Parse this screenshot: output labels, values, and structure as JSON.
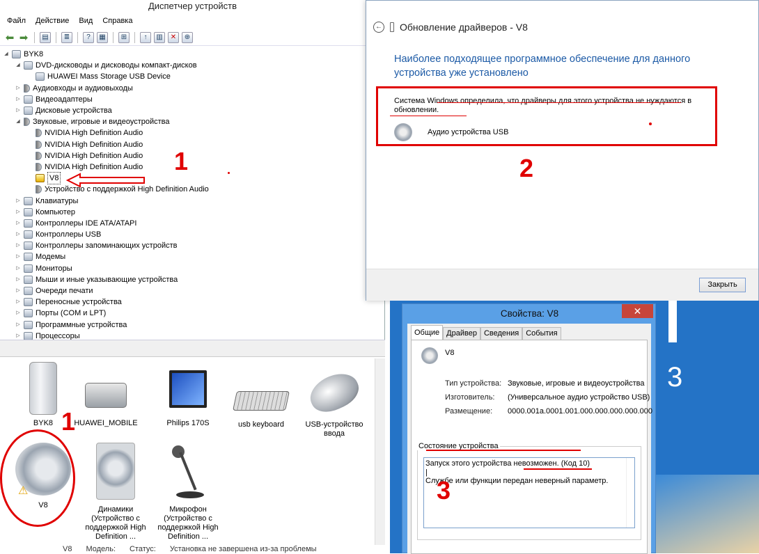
{
  "device_manager": {
    "title": "Диспетчер устройств",
    "menu": [
      "Файл",
      "Действие",
      "Вид",
      "Справка"
    ],
    "tree": [
      {
        "label": "BYK8",
        "level": 0,
        "expander": "◢",
        "icon": "computer-icon"
      },
      {
        "label": "DVD-дисководы и дисководы компакт-дисков",
        "level": 1,
        "expander": "◢",
        "icon": "dvd-drive-icon"
      },
      {
        "label": "HUAWEI Mass Storage USB Device",
        "level": 2,
        "expander": "",
        "icon": "dvd-drive-icon"
      },
      {
        "label": "Аудиовходы и аудиовыходы",
        "level": 1,
        "expander": "▷",
        "icon": "speaker-icon"
      },
      {
        "label": "Видеоадаптеры",
        "level": 1,
        "expander": "▷",
        "icon": "display-adapter-icon"
      },
      {
        "label": "Дисковые устройства",
        "level": 1,
        "expander": "▷",
        "icon": "disk-drive-icon"
      },
      {
        "label": "Звуковые, игровые и видеоустройства",
        "level": 1,
        "expander": "◢",
        "icon": "speaker-icon"
      },
      {
        "label": "NVIDIA High Definition Audio",
        "level": 2,
        "expander": "",
        "icon": "speaker-icon"
      },
      {
        "label": "NVIDIA High Definition Audio",
        "level": 2,
        "expander": "",
        "icon": "speaker-icon"
      },
      {
        "label": "NVIDIA High Definition Audio",
        "level": 2,
        "expander": "",
        "icon": "speaker-icon"
      },
      {
        "label": "NVIDIA High Definition Audio",
        "level": 2,
        "expander": "",
        "icon": "speaker-icon"
      },
      {
        "label": "V8",
        "level": 2,
        "expander": "",
        "icon": "warning-speaker-icon"
      },
      {
        "label": "Устройство с поддержкой High Definition Audio",
        "level": 2,
        "expander": "",
        "icon": "speaker-icon"
      },
      {
        "label": "Клавиатуры",
        "level": 1,
        "expander": "▷",
        "icon": "keyboard-icon"
      },
      {
        "label": "Компьютер",
        "level": 1,
        "expander": "▷",
        "icon": "computer-icon"
      },
      {
        "label": "Контроллеры IDE ATA/ATAPI",
        "level": 1,
        "expander": "▷",
        "icon": "ide-controller-icon"
      },
      {
        "label": "Контроллеры USB",
        "level": 1,
        "expander": "▷",
        "icon": "usb-icon"
      },
      {
        "label": "Контроллеры запоминающих устройств",
        "level": 1,
        "expander": "▷",
        "icon": "storage-controller-icon"
      },
      {
        "label": "Модемы",
        "level": 1,
        "expander": "▷",
        "icon": "modem-icon"
      },
      {
        "label": "Мониторы",
        "level": 1,
        "expander": "▷",
        "icon": "monitor-icon"
      },
      {
        "label": "Мыши и иные указывающие устройства",
        "level": 1,
        "expander": "▷",
        "icon": "mouse-icon"
      },
      {
        "label": "Очереди печати",
        "level": 1,
        "expander": "▷",
        "icon": "printer-icon"
      },
      {
        "label": "Переносные устройства",
        "level": 1,
        "expander": "▷",
        "icon": "portable-device-icon"
      },
      {
        "label": "Порты (COM и LPT)",
        "level": 1,
        "expander": "▷",
        "icon": "port-icon"
      },
      {
        "label": "Программные устройства",
        "level": 1,
        "expander": "▷",
        "icon": "software-device-icon"
      },
      {
        "label": "Процессоры",
        "level": 1,
        "expander": "▷",
        "icon": "processor-icon"
      }
    ],
    "devices": [
      {
        "label": "BYK8",
        "icon": "computer-tower-icon"
      },
      {
        "label": "HUAWEI_MOBILE",
        "icon": "drive-icon"
      },
      {
        "label": "Philips 170S",
        "icon": "monitor-icon"
      },
      {
        "label": "usb keyboard",
        "icon": "keyboard-icon"
      },
      {
        "label": "USB-устройство ввода",
        "icon": "mouse-icon"
      },
      {
        "label": "V8",
        "icon": "warning-speaker-icon"
      },
      {
        "label": "Динамики (Устройство с поддержкой High Definition ...",
        "icon": "speakers-icon"
      },
      {
        "label": "Микрофон (Устройство с поддержкой High Definition ...",
        "icon": "microphone-icon"
      }
    ],
    "status_line": [
      "V8",
      "Модель:",
      "Статус:",
      "Установка не завершена из-за проблемы"
    ]
  },
  "driver_update": {
    "title": "Обновление драйверов - V8",
    "message": "Наиболее подходящее программное обеспечение для данного устройства уже установлено",
    "detail": "Система Windows определила, что драйверы для этого устройства не нуждаются в обновлении.",
    "device_name": "Аудио устройства USB",
    "close_label": "Закрыть"
  },
  "properties": {
    "title": "Свойства: V8",
    "close_glyph": "✕",
    "tabs": [
      "Общие",
      "Драйвер",
      "Сведения",
      "События"
    ],
    "device_name": "V8",
    "rows": [
      {
        "label": "Тип устройства:",
        "value": "Звуковые, игровые и видеоустройства"
      },
      {
        "label": "Изготовитель:",
        "value": "(Универсальное аудио устройство USB)"
      },
      {
        "label": "Размещение:",
        "value": "0000.001a.0001.001.000.000.000.000.000"
      }
    ],
    "status_group_label": "Состояние устройства",
    "status_line1": "Запуск этого устройства невозможен. (Код 10)",
    "status_line2": "Службе или функции передан неверный параметр."
  },
  "desktop_digit": "3",
  "annotations": {
    "n1a": "1",
    "n1b": "1",
    "n2": "2",
    "n3": "3"
  },
  "colors": {
    "accent": "#1c5aa6",
    "annotation": "#e00000",
    "desktop": "#2473c6",
    "close": "#c7453a"
  }
}
